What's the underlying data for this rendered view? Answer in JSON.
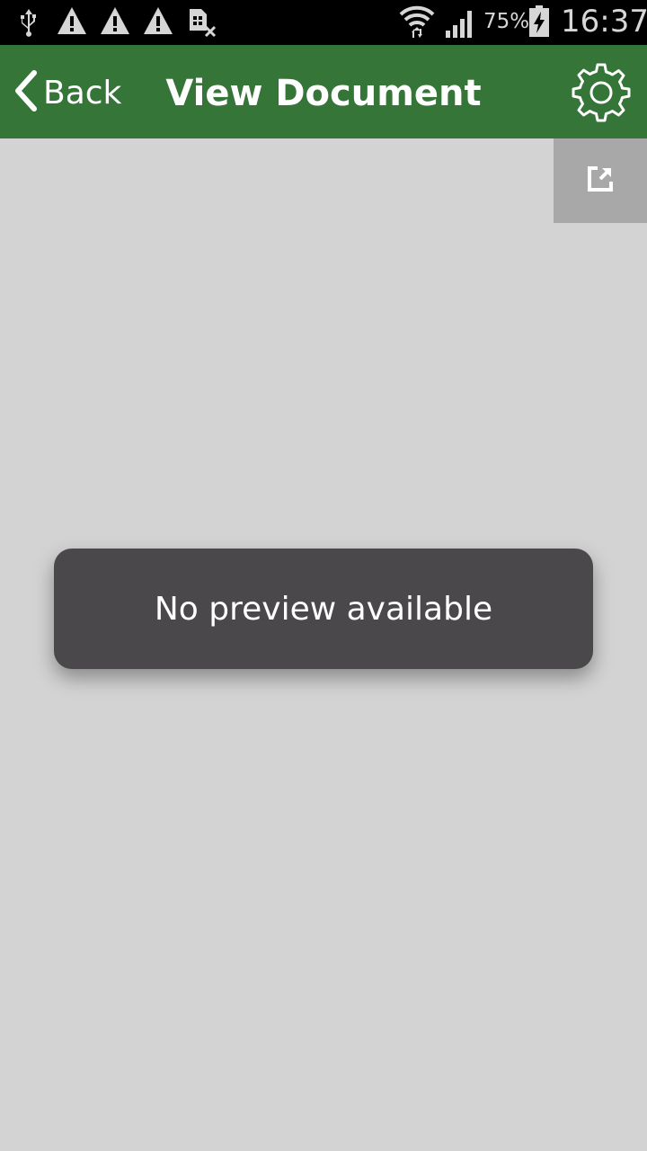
{
  "status_bar": {
    "battery_percent": "75%",
    "time": "16:37",
    "icons": [
      "usb-icon",
      "warning-icon",
      "warning-icon",
      "warning-icon",
      "no-sim-icon",
      "wifi-icon",
      "signal-icon",
      "battery-charging-icon"
    ]
  },
  "header": {
    "back_label": "Back",
    "title": "View Document",
    "settings_icon": "gear-icon"
  },
  "toolbar": {
    "open_external_icon": "open-external-icon"
  },
  "toast": {
    "message": "No preview available"
  },
  "colors": {
    "app_bar": "#367538",
    "background": "#d3d3d3",
    "toast": "#4a484b",
    "status_bar": "#000000"
  }
}
